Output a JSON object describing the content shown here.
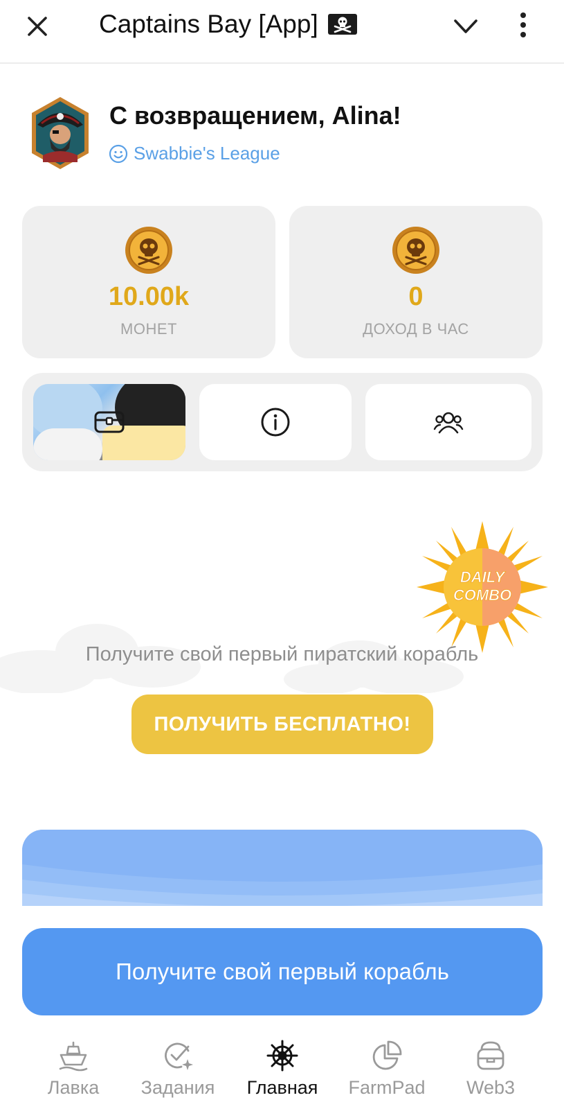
{
  "header": {
    "title": "Captains Bay [App]",
    "flag_icon": "pirate-flag-icon"
  },
  "profile": {
    "greeting": "С возвращением, Alina!",
    "league": "Swabbie's League",
    "league_color": "#5aa0e6"
  },
  "stats": {
    "coins": {
      "value": "10.00k",
      "label": "МОНЕТ"
    },
    "income": {
      "value": "0",
      "label": "ДОХОД В ЧАС"
    },
    "value_color": "#e0a81a"
  },
  "actions": {
    "items": [
      {
        "icon": "chest-icon"
      },
      {
        "icon": "info-icon"
      },
      {
        "icon": "friends-icon"
      }
    ]
  },
  "daily_combo": {
    "line1": "DAILY",
    "line2": "COMBO"
  },
  "promo": {
    "text": "Получите свой первый пиратский корабль",
    "button_label": "ПОЛУЧИТЬ БЕСПЛАТНО!",
    "button_color": "#edc442"
  },
  "cta": {
    "label": "Получите свой первый корабль",
    "color": "#5498f1"
  },
  "bottom_nav": {
    "items": [
      {
        "label": "Лавка",
        "icon": "ship-icon"
      },
      {
        "label": "Задания",
        "icon": "tasks-icon"
      },
      {
        "label": "Главная",
        "icon": "helm-icon",
        "active": true
      },
      {
        "label": "FarmPad",
        "icon": "pie-chart-icon"
      },
      {
        "label": "Web3",
        "icon": "wallet-icon"
      }
    ]
  }
}
